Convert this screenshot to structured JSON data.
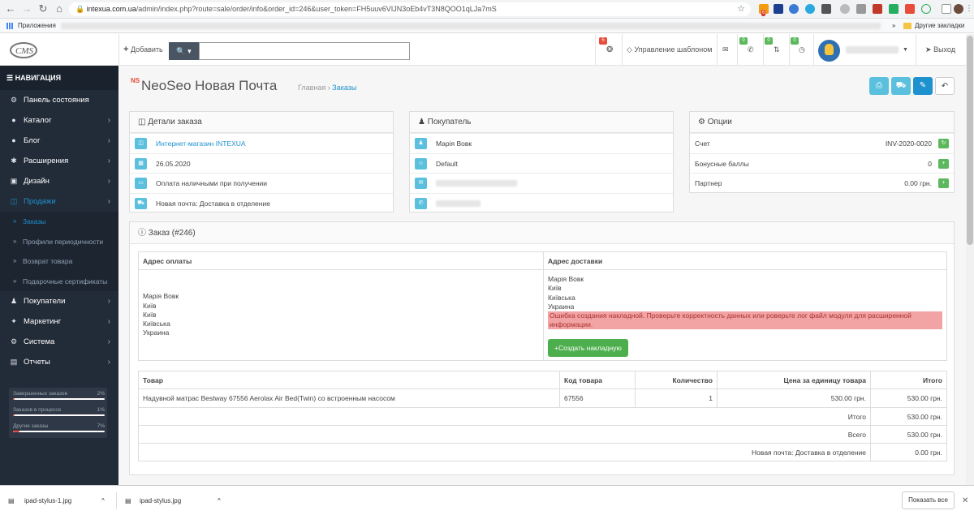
{
  "browser": {
    "url_host": "intexua.com.ua",
    "url_path": "/admin/index.php?route=sale/order/info&order_id=246&user_token=FH5uuv6VIJN3oEb4vT3N8QOO1qLJa7mS",
    "bookmark_apps": "Приложения",
    "other_bookmarks": "Другие закладки",
    "ext_badge": "6"
  },
  "header": {
    "add_label": "Добавить",
    "template_label": "Управление шаблоном",
    "badge_top": "5",
    "badge_a": "0",
    "badge_b": "0",
    "badge_c": "0",
    "logout_label": "Выход"
  },
  "sidebar": {
    "nav_title": "НАВИГАЦИЯ",
    "items": [
      {
        "label": "Панель состояния",
        "icon": "dashboard-icon"
      },
      {
        "label": "Каталог",
        "icon": "tag-icon"
      },
      {
        "label": "Блог",
        "icon": "tag-icon"
      },
      {
        "label": "Расширения",
        "icon": "puzzle-icon"
      },
      {
        "label": "Дизайн",
        "icon": "monitor-icon"
      },
      {
        "label": "Продажи",
        "icon": "cart-icon"
      }
    ],
    "sub_items": [
      "Заказы",
      "Профили периодичности",
      "Возврат товара",
      "Подарочные сертификаты"
    ],
    "items2": [
      {
        "label": "Покупатели",
        "icon": "user-icon"
      },
      {
        "label": "Маркетинг",
        "icon": "share-icon"
      },
      {
        "label": "Система",
        "icon": "cog-icon"
      },
      {
        "label": "Отчеты",
        "icon": "bar-chart-icon"
      }
    ],
    "stats": [
      {
        "label": "Завершенных заказов",
        "pct": "2%",
        "value": 0.02
      },
      {
        "label": "Заказов в процессе",
        "pct": "1%",
        "value": 0.01
      },
      {
        "label": "Другие заказы",
        "pct": "7%",
        "value": 0.07
      }
    ]
  },
  "page": {
    "brand": "NS",
    "title": "NeoSeo Новая Почта",
    "crumb_home": "Главная",
    "crumb_sep": "›",
    "crumb_orders": "Заказы"
  },
  "order_details": {
    "title": "Детали заказа",
    "store": "Интернет-магазин INTEXUA",
    "date": "26.05.2020",
    "payment": "Оплата наличными при получении",
    "shipping": "Новая почта: Доставка в отделение"
  },
  "customer": {
    "title": "Покупатель",
    "name": "Марія Вовк",
    "group": "Default"
  },
  "options": {
    "title": "Опции",
    "rows": [
      {
        "label": "Счет",
        "value": "INV-2020-0020"
      },
      {
        "label": "Бонусные баллы",
        "value": "0"
      },
      {
        "label": "Партнер",
        "value": "0.00 грн."
      }
    ]
  },
  "order": {
    "title": "Заказ (#246)",
    "billing_header": "Адрес оплаты",
    "shipping_header": "Адрес доставки",
    "billing_lines": [
      "Марія Вовк",
      "Київ",
      "Київ",
      "Київська",
      "Украина"
    ],
    "shipping_lines": [
      "Марія Вовк",
      "Київ",
      "Київська",
      "Украина"
    ],
    "error": "Ошибка создания накладной. Проверьте корректность данных или роверьте лог файл модуля для расширенной информации.",
    "create_button": "Создать накладную",
    "columns": [
      "Товар",
      "Код товара",
      "Количество",
      "Цена за единицу товара",
      "Итого"
    ],
    "product": {
      "name": "Надувной матрас Bestway 67556 Aerolax Air Bed(Twin) со встроенным насосом",
      "code": "67556",
      "qty": "1",
      "price": "530.00 грн.",
      "total": "530.00 грн."
    },
    "totals": [
      {
        "label": "Итого",
        "value": "530.00 грн."
      },
      {
        "label": "Всего",
        "value": "530.00 грн."
      },
      {
        "label": "Новая почта: Доставка в отделение",
        "value": "0.00 грн."
      }
    ]
  },
  "downloads": {
    "file1": "ipad-stylus-1.jpg",
    "file2": "ipad-stylus.jpg",
    "show_all": "Показать все"
  }
}
